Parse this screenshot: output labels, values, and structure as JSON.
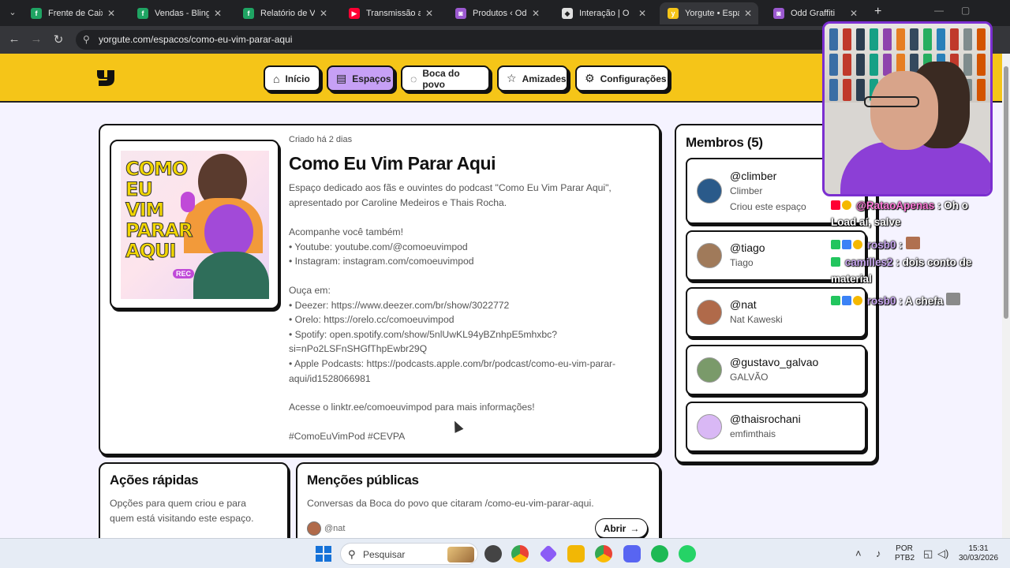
{
  "browser": {
    "tabs": [
      {
        "title": "Frente de Caixa - ",
        "color": "#1fa463",
        "glyph": "f",
        "active": false
      },
      {
        "title": "Vendas - Bling",
        "color": "#1fa463",
        "glyph": "f",
        "active": false
      },
      {
        "title": "Relatório de Vend",
        "color": "#1fa463",
        "glyph": "f",
        "active": false
      },
      {
        "title": "Transmissão ao vi",
        "color": "#ff0033",
        "glyph": "▶",
        "active": false
      },
      {
        "title": "Produtos ‹ Odd G",
        "color": "#9b59d0",
        "glyph": "◙",
        "active": false
      },
      {
        "title": "Interação | O ",
        "color": "#e0e0e0",
        "glyph": "◆",
        "active": false
      },
      {
        "title": "Yorgute • Espaço",
        "color": "#f5c518",
        "glyph": "y",
        "active": true
      },
      {
        "title": "Odd Graffiti",
        "color": "#9b59d0",
        "glyph": "◙",
        "active": false
      }
    ],
    "tab_close_glyph": "✕",
    "new_tab_glyph": "+",
    "url": "yorgute.com/espacos/como-eu-vim-parar-aqui"
  },
  "site": {
    "logo_icon": "yorgute-logo-icon",
    "nav": [
      {
        "label": "Início",
        "icon": "⌂",
        "icon_name": "home-icon"
      },
      {
        "label": "Espaços",
        "icon": "▤",
        "icon_name": "spaces-icon",
        "active": true
      },
      {
        "label": "Boca do povo",
        "icon": "◌",
        "icon_name": "chat-bubble-icon"
      },
      {
        "label": "Amizades",
        "icon": "☆",
        "icon_name": "star-icon"
      },
      {
        "label": "Configurações",
        "icon": "⚙",
        "icon_name": "settings-icon"
      }
    ]
  },
  "space": {
    "created": "Criado há 2 dias",
    "title": "Como Eu Vim Parar Aqui",
    "cover_text": "COMO EU VIM PARAR AQUI",
    "cover_badge": "REC",
    "description_lines": [
      "Espaço dedicado aos fãs e ouvintes do podcast \"Como Eu Vim Parar Aqui\",",
      "apresentado por Caroline Medeiros e Thais Rocha."
    ],
    "follow_lines": [
      "Acompanhe você também!",
      "• Youtube: youtube.com/@comoeuvimpod",
      "• Instagram: instagram.com/comoeuvimpod"
    ],
    "listen_lines": [
      "Ouça em:",
      "• Deezer: https://www.deezer.com/br/show/3022772",
      "• Orelo: https://orelo.cc/comoeuvimpod",
      "• Spotify: open.spotify.com/show/5nlUwKL94yBZnhpE5mhxbc?",
      "si=nPo2LSFnSHGfThpEwbr29Q",
      "• Apple Podcasts: https://podcasts.apple.com/br/podcast/como-eu-vim-parar-",
      "aqui/id1528066981"
    ],
    "linktree": "Acesse o linktr.ee/comoeuvimpod para mais informações!",
    "hashtags": "#ComoEuVimPod #CEVPA"
  },
  "members": {
    "title": "Membros (5)",
    "items": [
      {
        "handle": "@climber",
        "name": "Climber",
        "note": "Criou este espaço",
        "avatar_color": "#2a5a8a"
      },
      {
        "handle": "@tiago",
        "name": "Tiago",
        "avatar_color": "#a07a5a"
      },
      {
        "handle": "@nat",
        "name": "Nat Kaweski",
        "avatar_color": "#b06a4a"
      },
      {
        "handle": "@gustavo_galvao",
        "name": "GALVÃO",
        "avatar_color": "#7a9a6a"
      },
      {
        "handle": "@thaisrochani",
        "name": "emfimthais",
        "avatar_color": "#d9b8f5"
      }
    ]
  },
  "quick_actions": {
    "title": "Ações rápidas",
    "text_lines": [
      "Opções para quem criou e para",
      "quem está visitando este espaço."
    ]
  },
  "mentions": {
    "title": "Menções públicas",
    "text": "Conversas da Boca do povo que citaram /como-eu-vim-parar-aqui.",
    "user": "@nat",
    "open_label": "Abrir",
    "open_icon": "→"
  },
  "stream_chat": [
    {
      "user": "@RataoApenas",
      "user_style": "pink",
      "msg": ": Oh o"
    },
    {
      "user": "",
      "msg": "Load aí, salve"
    },
    {
      "user": "rosb0",
      "msg": ":"
    },
    {
      "user": "camilles2",
      "msg": ": dois conto de"
    },
    {
      "user": "",
      "msg": "material"
    },
    {
      "user": "rosb0",
      "msg": ": A chefa"
    }
  ],
  "taskbar": {
    "search_placeholder": "Pesquisar",
    "lang_top": "POR",
    "lang_bottom": "PTB2",
    "time": "15:31",
    "date": "30/03/2026"
  }
}
